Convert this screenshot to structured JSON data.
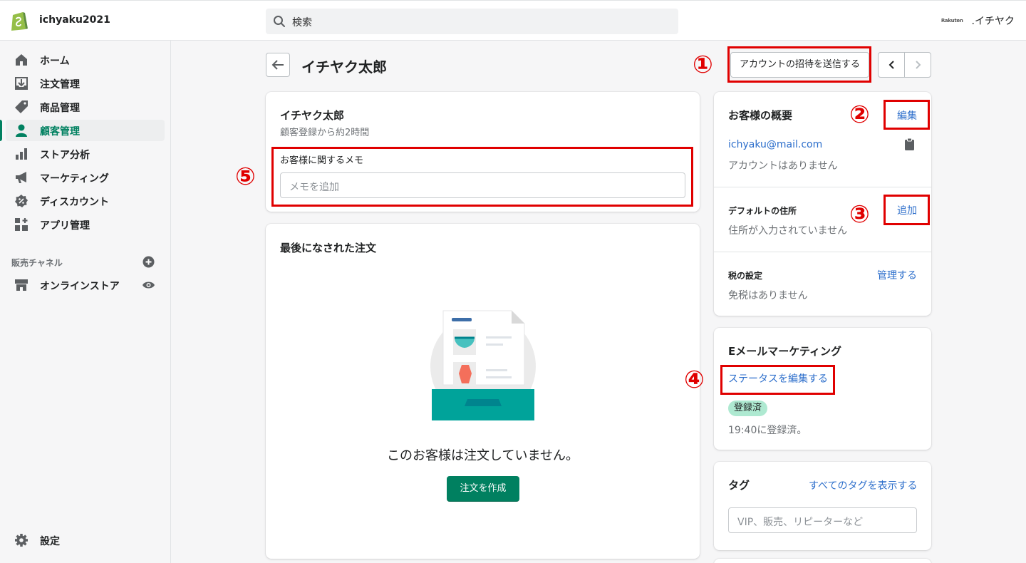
{
  "header": {
    "store_name": "ichyaku2021",
    "search_placeholder": "検索",
    "partner_logo": "Rakuten",
    "user_name": ".イチヤク"
  },
  "sidebar": {
    "items": [
      {
        "label": "ホーム",
        "icon": "home-icon"
      },
      {
        "label": "注文管理",
        "icon": "orders-icon"
      },
      {
        "label": "商品管理",
        "icon": "tag-icon"
      },
      {
        "label": "顧客管理",
        "icon": "customer-icon",
        "active": true
      },
      {
        "label": "ストア分析",
        "icon": "analytics-icon"
      },
      {
        "label": "マーケティング",
        "icon": "megaphone-icon"
      },
      {
        "label": "ディスカウント",
        "icon": "discount-icon"
      },
      {
        "label": "アプリ管理",
        "icon": "apps-icon"
      }
    ],
    "channels_title": "販売チャネル",
    "online_store": "オンラインストア",
    "settings": "設定"
  },
  "page": {
    "title": "イチヤク太郎",
    "invite_button": "アカウントの招待を送信する"
  },
  "customer_card": {
    "name": "イチヤク太郎",
    "registered": "顧客登録から約2時間",
    "memo_label": "お客様に関するメモ",
    "memo_placeholder": "メモを追加"
  },
  "orders_card": {
    "title": "最後になされた注文",
    "empty_text": "このお客様は注文していません。",
    "create_button": "注文を作成"
  },
  "overview_card": {
    "title": "お客様の概要",
    "edit_link": "編集",
    "email": "ichyaku@mail.com",
    "account_status": "アカウントはありません",
    "address_title": "デフォルトの住所",
    "address_add_link": "追加",
    "address_status": "住所が入力されていません",
    "tax_title": "税の設定",
    "tax_manage_link": "管理する",
    "tax_status": "免税はありません"
  },
  "email_marketing_card": {
    "title": "Eメールマーケティング",
    "edit_status_link": "ステータスを編集する",
    "badge": "登録済",
    "subscribed_text": "19:40に登録済。"
  },
  "tags_card": {
    "title": "タグ",
    "view_all_link": "すべてのタグを表示する",
    "placeholder": "VIP、販売、リピーターなど"
  },
  "annotations": [
    "①",
    "②",
    "③",
    "④",
    "⑤"
  ],
  "colors": {
    "accent": "#008060",
    "link": "#2c6ecb",
    "annotation": "#e00000",
    "badge": "#aee9d1"
  }
}
